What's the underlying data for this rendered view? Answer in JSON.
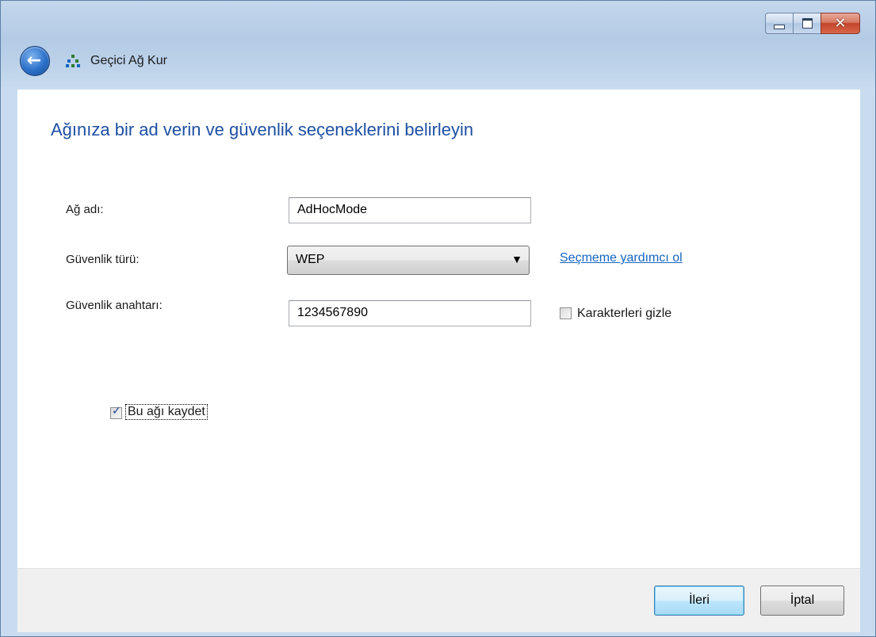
{
  "window": {
    "title": "Geçici Ağ Kur",
    "controls": {
      "minimize": "minimize",
      "maximize": "maximize",
      "close": "✕"
    }
  },
  "page": {
    "heading": "Ağınıza bir ad verin ve güvenlik seçeneklerini belirleyin"
  },
  "form": {
    "network_name_label": "Ağ adı:",
    "network_name_value": "AdHocMode",
    "security_type_label": "Güvenlik türü:",
    "security_type_value": "WEP",
    "help_link": "Seçmeme yardımcı ol",
    "security_key_label": "Güvenlik anahtarı:",
    "security_key_value": "1234567890",
    "hide_chars_label": "Karakterleri gizle",
    "hide_chars_checked": false,
    "save_network_label": "Bu ağı kaydet",
    "save_network_checked": true
  },
  "footer": {
    "next_label": "İleri",
    "cancel_label": "İptal"
  },
  "icons": {
    "back": "back-arrow-icon",
    "network": "network-icon"
  },
  "colors": {
    "heading": "#1e4fa3",
    "link": "#1565c0",
    "frame": "#bcd2ea"
  }
}
